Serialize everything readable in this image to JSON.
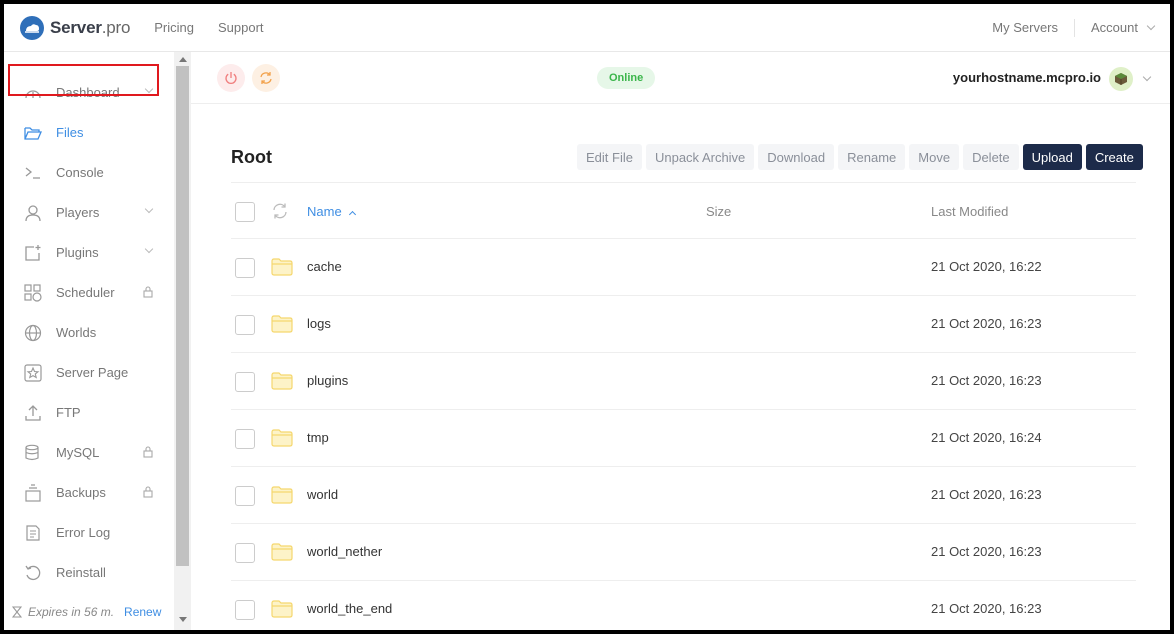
{
  "brand": {
    "name_bold": "Server",
    "name_light": ".pro"
  },
  "topnav": {
    "links": [
      "Pricing",
      "Support"
    ],
    "my_servers": "My Servers",
    "account": "Account"
  },
  "sidebar": {
    "items": [
      {
        "label": "Dashboard",
        "icon": "gauge-icon",
        "chevron": true,
        "locked": false,
        "active": false
      },
      {
        "label": "Files",
        "icon": "folder-open-icon",
        "chevron": false,
        "locked": false,
        "active": true
      },
      {
        "label": "Console",
        "icon": "terminal-icon",
        "chevron": false,
        "locked": false,
        "active": false
      },
      {
        "label": "Players",
        "icon": "user-icon",
        "chevron": true,
        "locked": false,
        "active": false
      },
      {
        "label": "Plugins",
        "icon": "plugin-icon",
        "chevron": true,
        "locked": false,
        "active": false
      },
      {
        "label": "Scheduler",
        "icon": "scheduler-icon",
        "chevron": false,
        "locked": true,
        "active": false
      },
      {
        "label": "Worlds",
        "icon": "globe-icon",
        "chevron": false,
        "locked": false,
        "active": false
      },
      {
        "label": "Server Page",
        "icon": "star-icon",
        "chevron": false,
        "locked": false,
        "active": false
      },
      {
        "label": "FTP",
        "icon": "upload-icon",
        "chevron": false,
        "locked": false,
        "active": false
      },
      {
        "label": "MySQL",
        "icon": "database-icon",
        "chevron": false,
        "locked": true,
        "active": false
      },
      {
        "label": "Backups",
        "icon": "backup-icon",
        "chevron": false,
        "locked": true,
        "active": false
      },
      {
        "label": "Error Log",
        "icon": "log-icon",
        "chevron": false,
        "locked": false,
        "active": false
      },
      {
        "label": "Reinstall",
        "icon": "reinstall-icon",
        "chevron": false,
        "locked": false,
        "active": false
      }
    ],
    "expires": "Expires in 56 m.",
    "renew": "Renew"
  },
  "server": {
    "status": "Online",
    "hostname": "yourhostname.mcpro.io"
  },
  "files": {
    "title": "Root",
    "toolbar": [
      "Edit File",
      "Unpack Archive",
      "Download",
      "Rename",
      "Move",
      "Delete",
      "Upload",
      "Create"
    ],
    "columns": {
      "name": "Name",
      "size": "Size",
      "modified": "Last Modified"
    },
    "rows": [
      {
        "name": "cache",
        "modified": "21 Oct 2020, 16:22"
      },
      {
        "name": "logs",
        "modified": "21 Oct 2020, 16:23"
      },
      {
        "name": "plugins",
        "modified": "21 Oct 2020, 16:23"
      },
      {
        "name": "tmp",
        "modified": "21 Oct 2020, 16:24"
      },
      {
        "name": "world",
        "modified": "21 Oct 2020, 16:23"
      },
      {
        "name": "world_nether",
        "modified": "21 Oct 2020, 16:23"
      },
      {
        "name": "world_the_end",
        "modified": "21 Oct 2020, 16:23"
      }
    ]
  },
  "colors": {
    "accent": "#3f8ee3",
    "dark_button": "#1d2b4a",
    "online_green": "#3ab54a",
    "highlight": "#e0191e"
  }
}
